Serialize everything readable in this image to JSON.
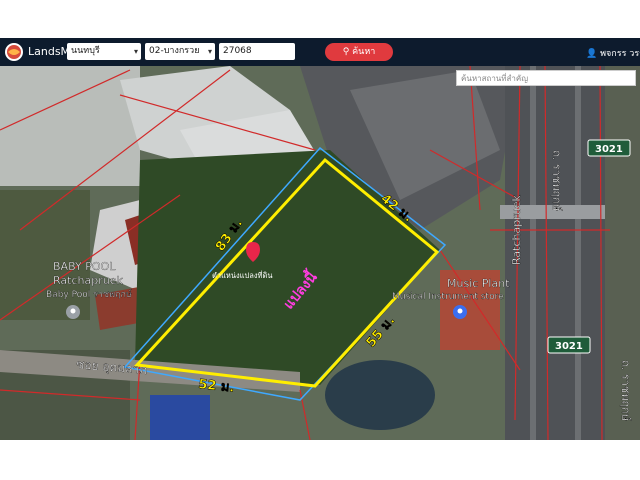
{
  "header": {
    "app_name": "LandsMaps",
    "province": "นนทบุรี",
    "district": "02-บางกรวย",
    "parcel_no": "27068",
    "search_label": "ค้นหา",
    "user_name": "พจกรร วรรณ"
  },
  "map": {
    "place_search_placeholder": "ค้นหาสถานที่สำคัญ",
    "parcel_label": "แปลงนี้",
    "pin_label": "ตำแหน่งแปลงที่ดิน",
    "sides": [
      "83 ม.",
      "42 ม.",
      "55 ม.",
      "52 ม."
    ],
    "labels": {
      "baby_pool": "BABY POOL",
      "ratchapruek_en": "Ratchapruek",
      "baby_pool_th": "Baby Pool ราชพฤกษ์",
      "music_plant": "Music Plant",
      "music_store": "Musical Instrument store",
      "road_en": "Ratchapruek",
      "road_th": "ถ. ราชพฤกษ์",
      "soi": "ซอย อุดมลาภ",
      "shield_1": "3021",
      "shield_2": "3021"
    },
    "colors": {
      "parcel_outline": "#ffee00",
      "dimension_text": "#ffee00",
      "parcel_label": "#ff3de0",
      "boundaries": "#d12a2a",
      "road_shield": "#1f5c3a"
    }
  }
}
